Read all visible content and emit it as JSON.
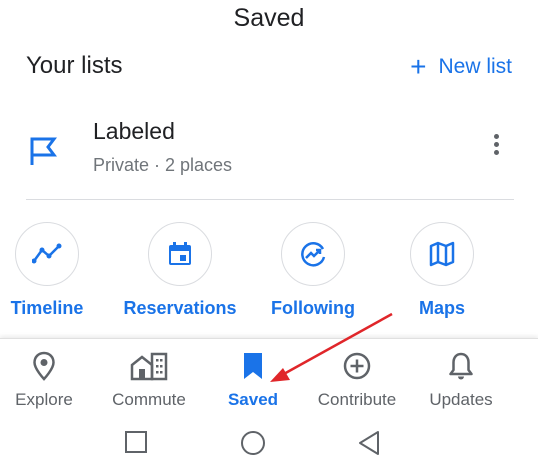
{
  "header": {
    "title": "Saved"
  },
  "lists_section": {
    "heading": "Your lists",
    "new_list_label": "New list"
  },
  "list": {
    "name": "Labeled",
    "meta": "Private · 2 places"
  },
  "shortcuts": [
    {
      "label": "Timeline",
      "icon": "timeline-icon"
    },
    {
      "label": "Reservations",
      "icon": "calendar-icon"
    },
    {
      "label": "Following",
      "icon": "following-icon"
    },
    {
      "label": "Maps",
      "icon": "map-icon"
    }
  ],
  "bottom_nav": [
    {
      "label": "Explore",
      "icon": "location-pin-icon"
    },
    {
      "label": "Commute",
      "icon": "commute-icon"
    },
    {
      "label": "Saved",
      "icon": "bookmark-icon",
      "active": true
    },
    {
      "label": "Contribute",
      "icon": "add-circle-icon"
    },
    {
      "label": "Updates",
      "icon": "bell-icon"
    }
  ],
  "system_nav": [
    "recent-apps-icon",
    "home-icon",
    "back-icon"
  ],
  "colors": {
    "accent": "#1a73e8",
    "annotation_arrow": "#e0262a"
  }
}
